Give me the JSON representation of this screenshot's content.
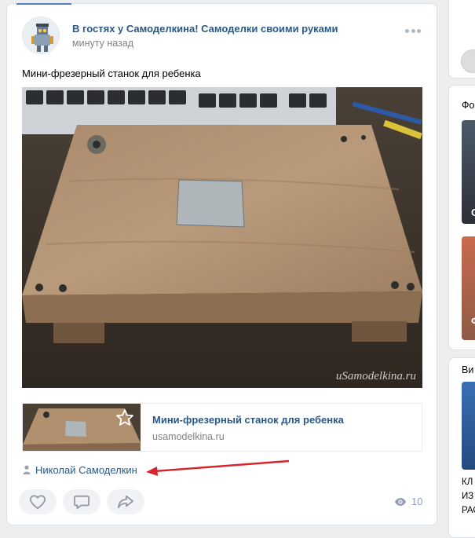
{
  "post": {
    "group_name": "В гостях у Самоделкина! Самоделки своими руками",
    "time": "минуту назад",
    "text": "Мини-фрезерный станок для ребенка",
    "photo_watermark": "uSamodelkina.ru",
    "link": {
      "title": "Мини-фрезерный станок для ребенка",
      "domain": "usamodelkina.ru"
    },
    "author": "Николай Самоделкин",
    "views": "10",
    "icons": [
      "more-icon",
      "star-icon",
      "author-icon",
      "like-icon",
      "comment-icon",
      "share-icon",
      "views-icon"
    ]
  },
  "right_column": {
    "header_2": "Фо",
    "header_3": "Ви",
    "thumb_1_letter": "С",
    "thumb_2_letter": "Ф",
    "text_lines": [
      "КЛ",
      "ИЗ",
      "РАС"
    ]
  },
  "colors": {
    "link": "#2a5885",
    "muted": "#828282",
    "annotation_arrow": "#d7262b"
  }
}
